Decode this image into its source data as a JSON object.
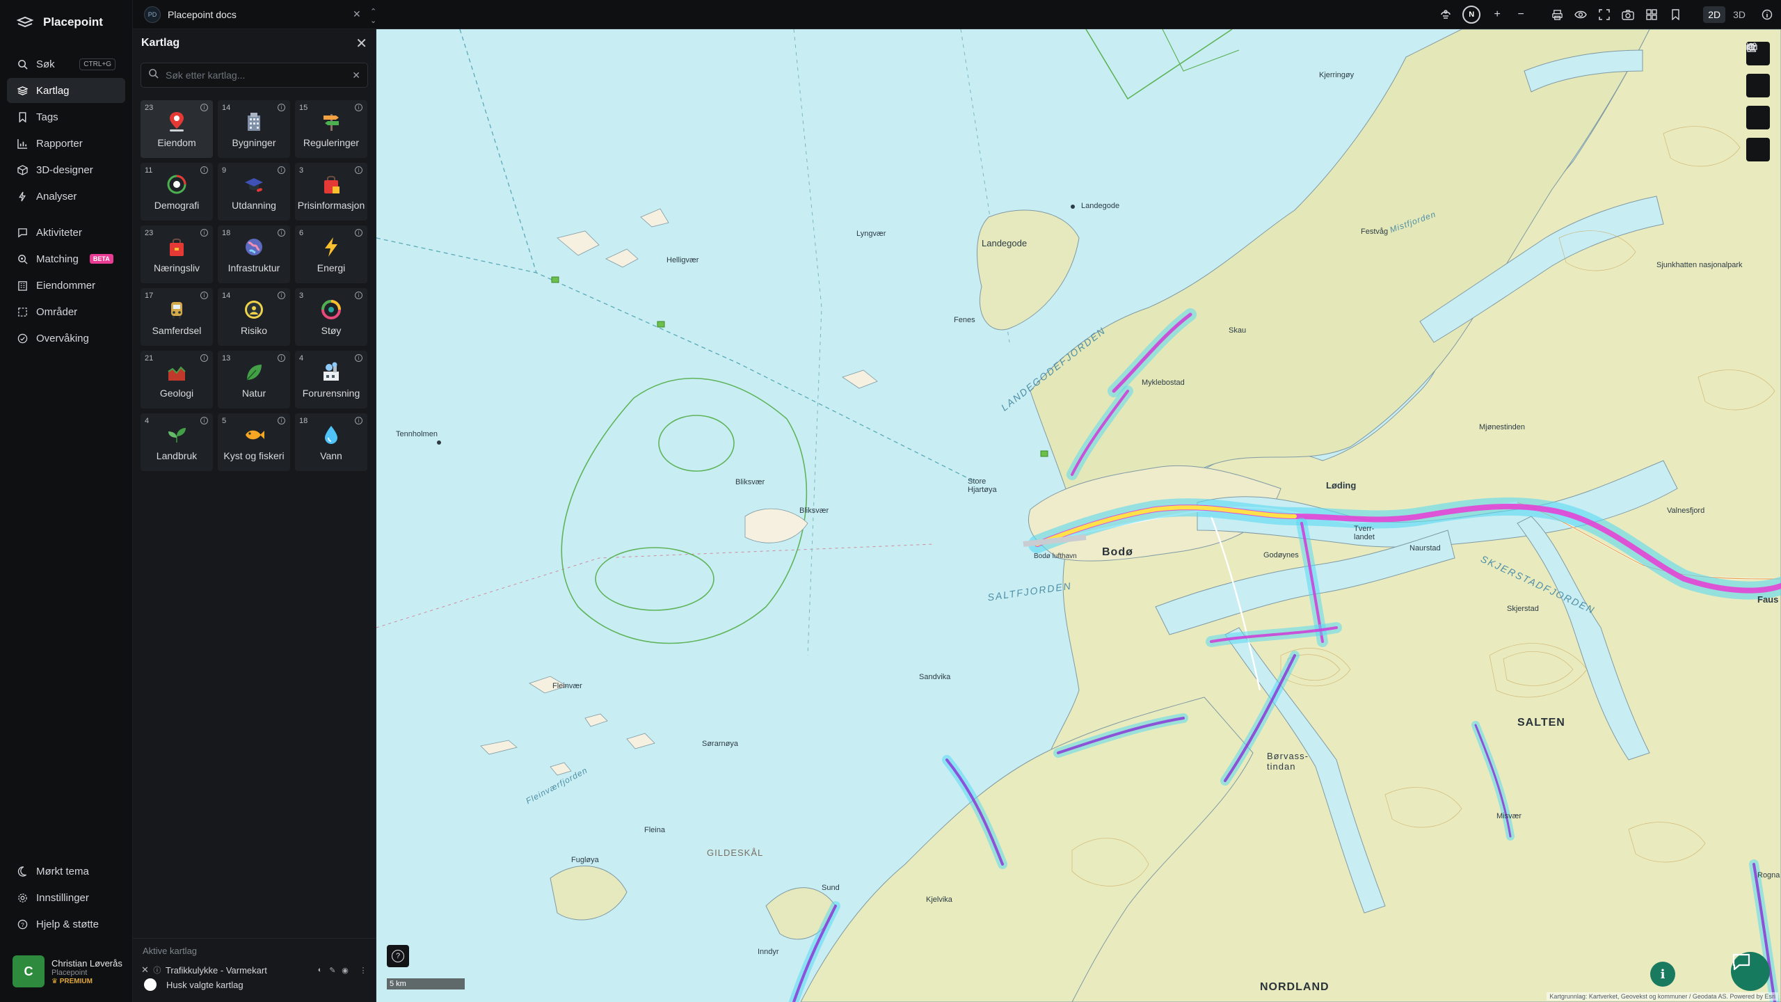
{
  "app": {
    "name": "Placepoint"
  },
  "nav": {
    "items": [
      {
        "label": "Søk",
        "shortcut": "CTRL+G",
        "icon": "search-icon"
      },
      {
        "label": "Kartlag",
        "icon": "layers-icon",
        "active": true
      },
      {
        "label": "Tags",
        "icon": "bookmark-icon"
      },
      {
        "label": "Rapporter",
        "icon": "bar-chart-icon"
      },
      {
        "label": "3D-designer",
        "icon": "cube-icon"
      },
      {
        "label": "Analyser",
        "icon": "bolt-icon"
      }
    ],
    "items2": [
      {
        "label": "Aktiviteter",
        "icon": "chat-icon"
      },
      {
        "label": "Matching",
        "badge": "BETA",
        "icon": "search-match-icon"
      },
      {
        "label": "Eiendommer",
        "icon": "building-icon"
      },
      {
        "label": "Områder",
        "icon": "area-icon"
      },
      {
        "label": "Overvåking",
        "icon": "monitor-icon"
      }
    ],
    "bottom": [
      {
        "label": "Mørkt tema",
        "icon": "moon-icon"
      },
      {
        "label": "Innstillinger",
        "icon": "gear-icon"
      },
      {
        "label": "Hjelp & støtte",
        "icon": "help-icon"
      }
    ]
  },
  "user": {
    "initial": "C",
    "name": "Christian Løverås",
    "org": "Placepoint",
    "tier": "PREMIUM"
  },
  "workspace": {
    "badge": "PD",
    "name": "Placepoint docs"
  },
  "toolbar": {
    "compass": "N",
    "dim_2d": "2D",
    "dim_3d": "3D"
  },
  "panel": {
    "title": "Kartlag",
    "search_placeholder": "Søk etter kartlag...",
    "categories": [
      {
        "count": "23",
        "label": "Eiendom",
        "icon": "property-pin-icon",
        "color": "#e53935"
      },
      {
        "count": "14",
        "label": "Bygninger",
        "icon": "buildings-icon",
        "color": "#7f8fa6"
      },
      {
        "count": "15",
        "label": "Reguleringer",
        "icon": "signpost-icon",
        "color": "#f4a142"
      },
      {
        "count": "11",
        "label": "Demografi",
        "icon": "demographics-icon",
        "color": "#4caf50"
      },
      {
        "count": "9",
        "label": "Utdanning",
        "icon": "graduation-cap-icon",
        "color": "#3f51b5"
      },
      {
        "count": "3",
        "label": "Prisinformasjon",
        "icon": "shopping-bag-icon",
        "color": "#e53935"
      },
      {
        "count": "23",
        "label": "Næringsliv",
        "icon": "business-bag-icon",
        "color": "#e53935"
      },
      {
        "count": "18",
        "label": "Infrastruktur",
        "icon": "globe-icon",
        "color": "#5c6bc0"
      },
      {
        "count": "6",
        "label": "Energi",
        "icon": "lightning-icon",
        "color": "#fbc02d"
      },
      {
        "count": "17",
        "label": "Samferdsel",
        "icon": "bus-icon",
        "color": "#d4a94a"
      },
      {
        "count": "14",
        "label": "Risiko",
        "icon": "hazard-icon",
        "color": "#f0d24a"
      },
      {
        "count": "3",
        "label": "Støy",
        "icon": "noise-gauge-icon",
        "color": "#e64a7b"
      },
      {
        "count": "21",
        "label": "Geologi",
        "icon": "geology-icon",
        "color": "#c0392b"
      },
      {
        "count": "13",
        "label": "Natur",
        "icon": "leaf-icon",
        "color": "#43a047"
      },
      {
        "count": "4",
        "label": "Forurensning",
        "icon": "factory-icon",
        "color": "#90caf9"
      },
      {
        "count": "4",
        "label": "Landbruk",
        "icon": "sprout-icon",
        "color": "#43a047"
      },
      {
        "count": "5",
        "label": "Kyst og fiskeri",
        "icon": "fish-icon",
        "color": "#f5a623"
      },
      {
        "count": "18",
        "label": "Vann",
        "icon": "water-drop-icon",
        "color": "#4fc3f7"
      }
    ],
    "active_title": "Aktive kartlag",
    "active_layers": [
      {
        "name": "Trafikkulykke - Varmekart"
      }
    ],
    "remember_label": "Husk valgte kartlag"
  },
  "map": {
    "labels": {
      "bodo": "Bodø",
      "loding": "Løding",
      "salten": "SALTEN",
      "nordland": "NORDLAND",
      "gildeskal": "GILDESKÅL",
      "saltfjorden": "SALTFJORDEN",
      "landegodefjorden": "LANDEGODEFJORDEN",
      "skjerstadfjorden": "SKJERSTADFJORDEN",
      "fleinvaerfjorden": "Fleinværfjorden",
      "landegode": "Landegode",
      "landegode2": "Landegode",
      "lyngvaer": "Lyngvær",
      "helligvaer": "Helligvær",
      "tennholmen": "Tennholmen",
      "bliksvaer": "Bliksvær",
      "bliksvaer2": "Bliksvær",
      "store_hjartoya": "Store Hjartøya",
      "bodo_lufthavn": "Bodø lufthavn",
      "fleinvaer": "Fleinvær",
      "valnesfjord": "Valnesfjord",
      "fauske": "Faus",
      "sandvika": "Sandvika",
      "naurstad": "Naurstad",
      "misvaer": "Misvær",
      "rognan": "Rogna",
      "mjonestinden": "Mjønestinden",
      "sjunkhatten": "Sjunkhatten nasjonalpark",
      "festvag": "Festvåg",
      "kjerringoy": "Kjerringøy",
      "mistfjorden": "Mistfjorden",
      "fugloya": "Fugløya",
      "inndyr": "Inndyr",
      "sund": "Sund",
      "saravaer": "Sørarnøya",
      "fleina": "Fleina",
      "kjelvika": "Kjelvika",
      "tverrlandet": "Tverr-landet",
      "skjerstad": "Skjerstad",
      "borvass": "Børvass-tindan",
      "godoy": "Godøynes",
      "fenes": "Fenes",
      "myklebostad": "Myklebostad",
      "skau": "Skau"
    },
    "scale": "5 km",
    "attribution": "Kartgrunnlag: Kartverket, Geovekst og kommuner / Geodata AS. Powered by Esri",
    "help": "?",
    "info": "i"
  }
}
